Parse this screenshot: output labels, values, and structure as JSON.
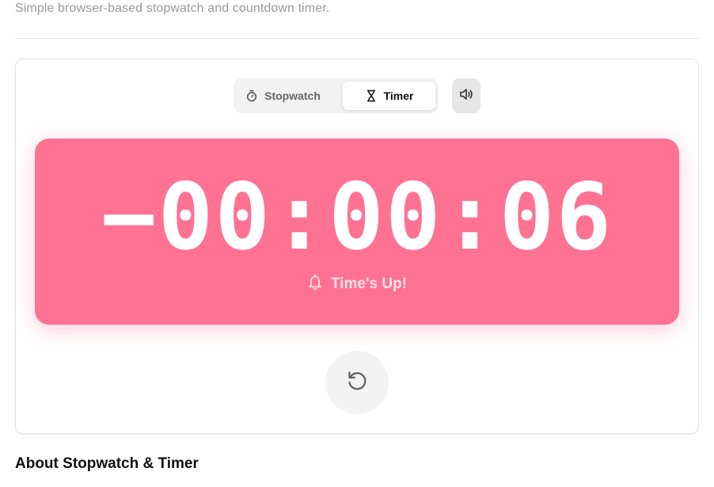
{
  "header": {
    "subtitle": "Simple browser-based stopwatch and countdown timer."
  },
  "modes": [
    {
      "label": "Stopwatch",
      "icon": "stopwatch-icon",
      "active": false
    },
    {
      "label": "Timer",
      "icon": "hourglass-icon",
      "active": true
    }
  ],
  "sound": {
    "icon": "speaker-icon"
  },
  "timer": {
    "display": "−00:00:06",
    "status": "Time's Up!",
    "status_icon": "bell-icon",
    "panel_color": "#ff7291"
  },
  "controls": {
    "reset_icon": "reset-icon"
  },
  "about": {
    "heading": "About Stopwatch & Timer"
  }
}
